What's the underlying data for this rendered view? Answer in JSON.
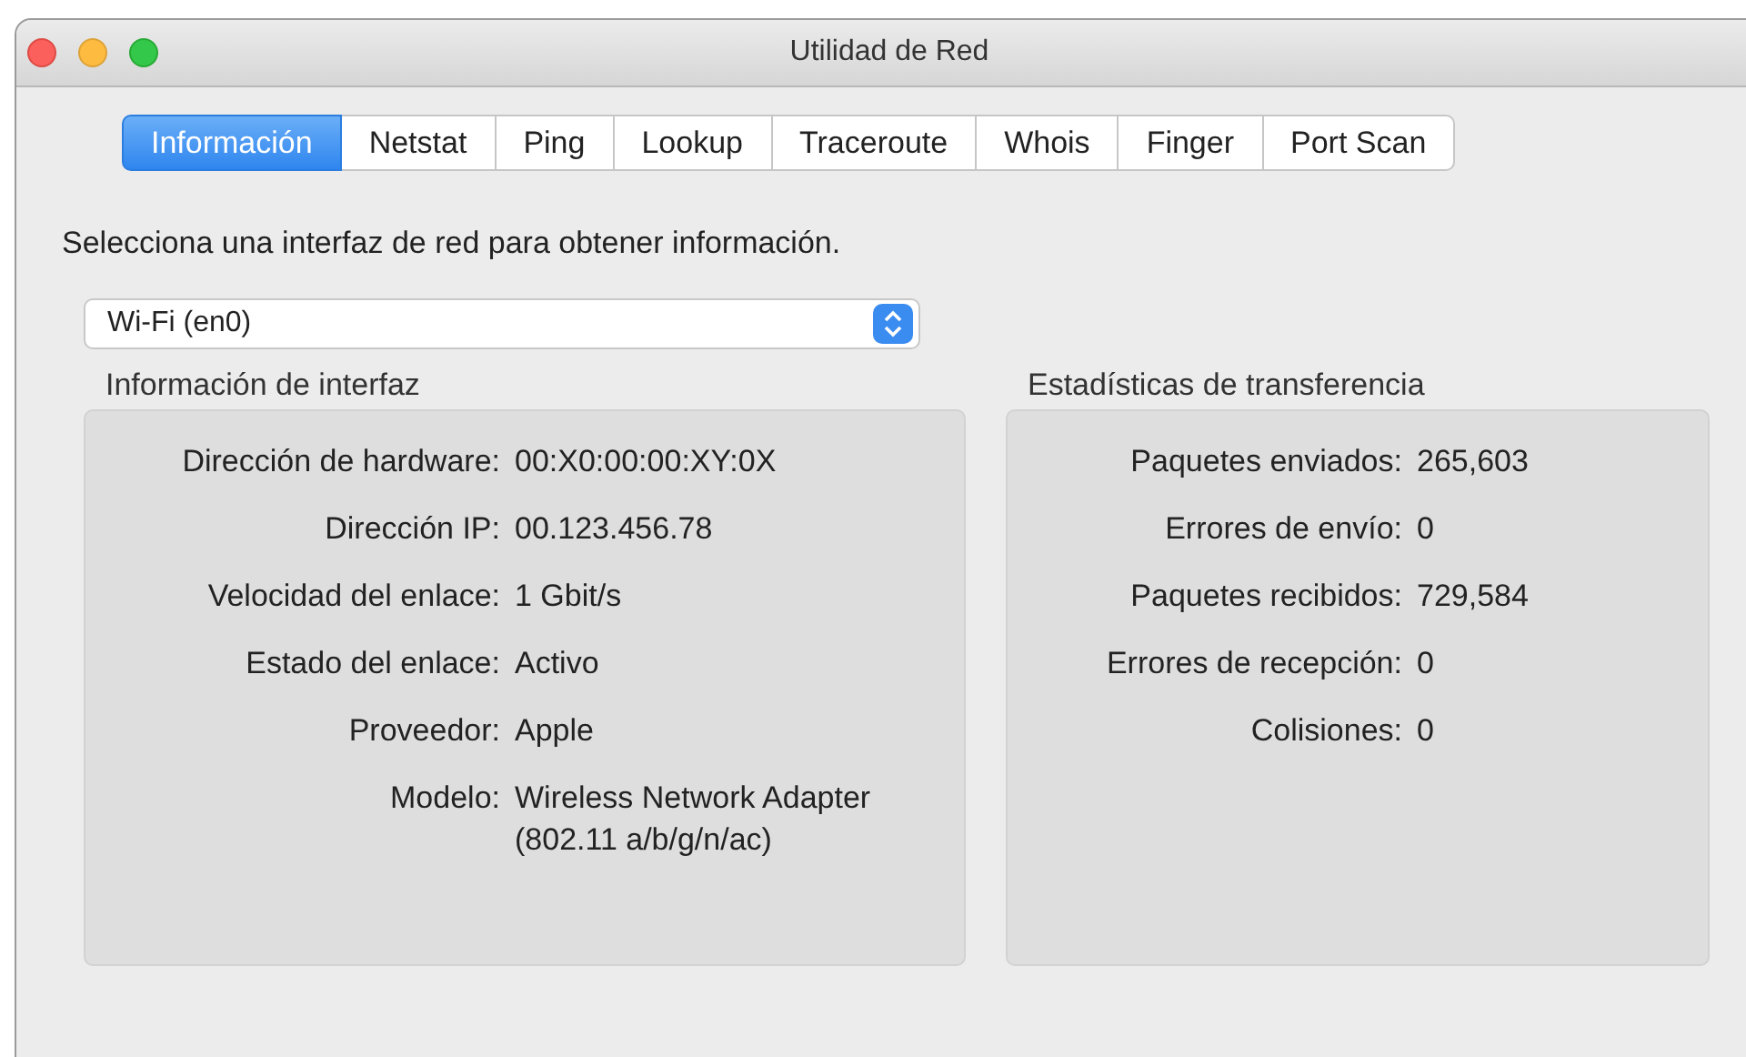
{
  "window": {
    "title": "Utilidad de Red"
  },
  "tabs": [
    {
      "label": "Información",
      "selected": true
    },
    {
      "label": "Netstat",
      "selected": false
    },
    {
      "label": "Ping",
      "selected": false
    },
    {
      "label": "Lookup",
      "selected": false
    },
    {
      "label": "Traceroute",
      "selected": false
    },
    {
      "label": "Whois",
      "selected": false
    },
    {
      "label": "Finger",
      "selected": false
    },
    {
      "label": "Port Scan",
      "selected": false
    }
  ],
  "prompt": "Selecciona una interfaz de red para obtener información.",
  "interface_select": {
    "value": "Wi-Fi (en0)"
  },
  "interface_info": {
    "title": "Información de interfaz",
    "rows": [
      {
        "label": "Dirección de hardware:",
        "value": "00:X0:00:00:XY:0X"
      },
      {
        "label": "Dirección IP:",
        "value": "00.123.456.78"
      },
      {
        "label": "Velocidad del enlace:",
        "value": "1 Gbit/s"
      },
      {
        "label": "Estado del enlace:",
        "value": "Activo"
      },
      {
        "label": "Proveedor:",
        "value": "Apple"
      },
      {
        "label": "Modelo:",
        "value": "Wireless Network Adapter (802.11 a/b/g/n/ac)"
      }
    ]
  },
  "transfer_stats": {
    "title": "Estadísticas de transferencia",
    "rows": [
      {
        "label": "Paquetes enviados:",
        "value": "265,603"
      },
      {
        "label": "Errores de envío:",
        "value": "0"
      },
      {
        "label": "Paquetes recibidos:",
        "value": "729,584"
      },
      {
        "label": "Errores de recepción:",
        "value": "0"
      },
      {
        "label": "Colisiones:",
        "value": "0"
      }
    ]
  }
}
